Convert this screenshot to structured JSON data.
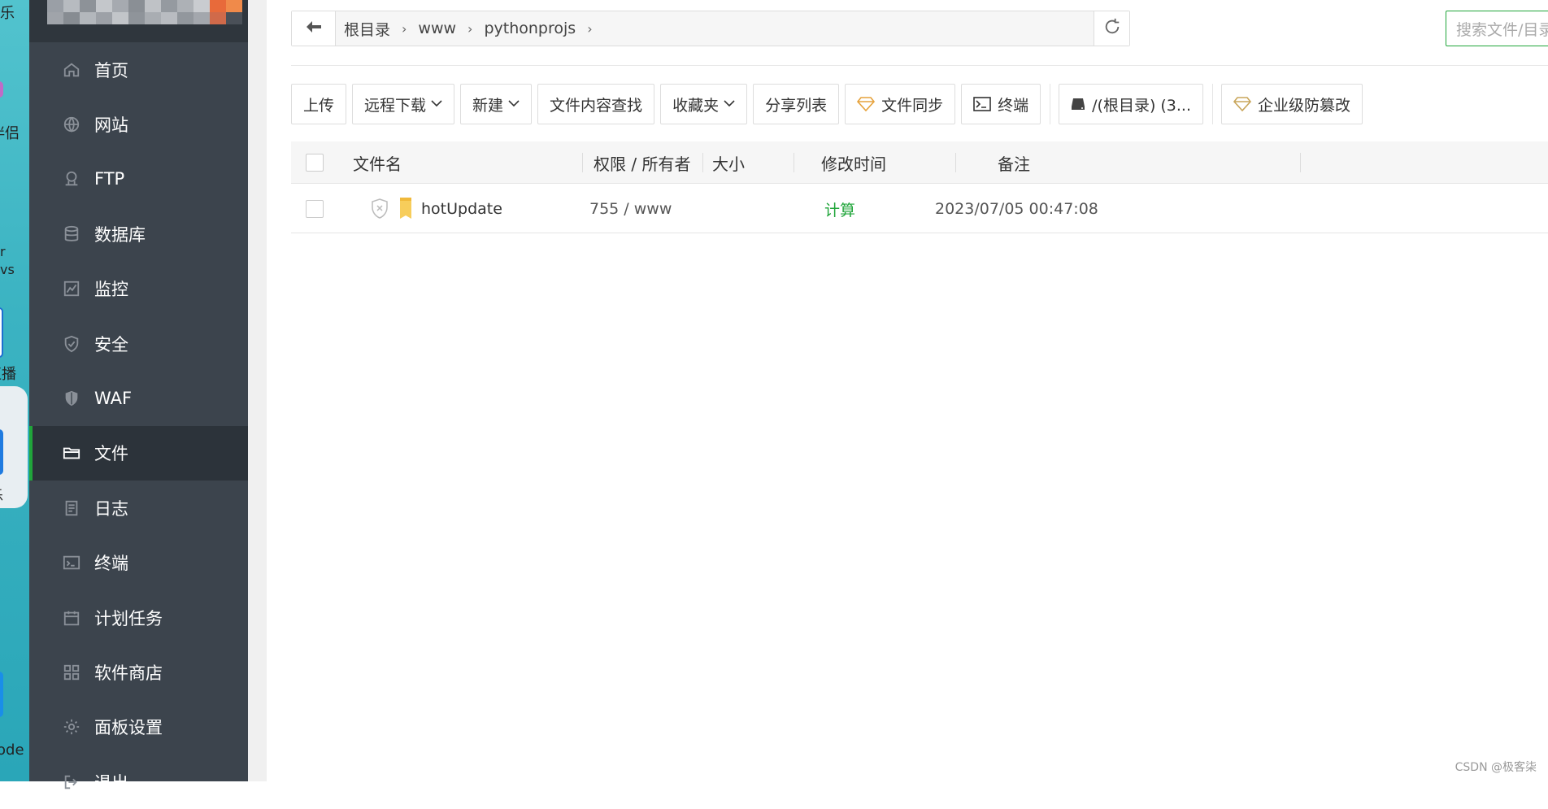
{
  "desktop": {
    "fragments": [
      "乐",
      "伴侣",
      "r",
      "vs",
      "直播",
      "乐",
      "ode"
    ]
  },
  "sidebar": {
    "items": [
      {
        "label": "首页",
        "icon": "home-icon"
      },
      {
        "label": "网站",
        "icon": "globe-icon"
      },
      {
        "label": "FTP",
        "icon": "ftp-icon"
      },
      {
        "label": "数据库",
        "icon": "database-icon"
      },
      {
        "label": "监控",
        "icon": "monitor-icon"
      },
      {
        "label": "安全",
        "icon": "shield-check-icon"
      },
      {
        "label": "WAF",
        "icon": "waf-shield-icon"
      },
      {
        "label": "文件",
        "icon": "folder-icon",
        "active": true
      },
      {
        "label": "日志",
        "icon": "log-icon"
      },
      {
        "label": "终端",
        "icon": "terminal-icon"
      },
      {
        "label": "计划任务",
        "icon": "calendar-icon"
      },
      {
        "label": "软件商店",
        "icon": "apps-grid-icon"
      },
      {
        "label": "面板设置",
        "icon": "gear-icon"
      },
      {
        "label": "退出",
        "icon": "logout-icon"
      }
    ],
    "accent": "#20a53a"
  },
  "path": {
    "crumbs": [
      "根目录",
      "www",
      "pythonprojs"
    ]
  },
  "search": {
    "placeholder": "搜索文件/目录"
  },
  "toolbar": {
    "upload": "上传",
    "remote_download": "远程下载",
    "new": "新建",
    "content_search": "文件内容查找",
    "favorites": "收藏夹",
    "share_list": "分享列表",
    "file_sync": "文件同步",
    "terminal": "终端",
    "disk": "/(根目录) (3...",
    "tamper_proof": "企业级防篡改"
  },
  "table": {
    "headers": {
      "name": "文件名",
      "perm": "权限 / 所有者",
      "size": "大小",
      "mtime": "修改时间",
      "note": "备注"
    },
    "rows": [
      {
        "name": "hotUpdate",
        "perm": "755 / www",
        "size": "计算",
        "mtime": "2023/07/05 00:47:08",
        "note": ""
      }
    ]
  },
  "footer": "CSDN @极客柒"
}
